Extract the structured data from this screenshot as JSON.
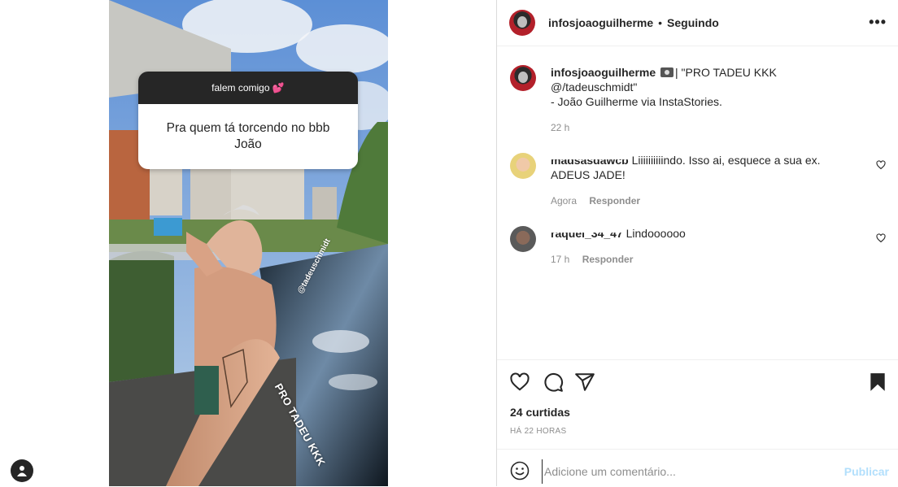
{
  "story": {
    "question_header": "falem comigo 💕",
    "question_text": "Pra quem tá torcendo  no bbb João",
    "mention_tag": "@tadeuschmidt",
    "caption_sticker": "PRO TADEU KKK"
  },
  "header": {
    "username": "infosjoaoguilherme",
    "separator": "•",
    "follow_status": "Seguindo"
  },
  "post": {
    "caption_user": "infosjoaoguilherme",
    "caption_line1": "| \"PRO TADEU KKK",
    "caption_line2": "@/tadeuschmidt\"",
    "caption_line3": "- João Guilherme via InstaStories.",
    "time": "22 h"
  },
  "comments": [
    {
      "user": "madsasdawcb",
      "text": "Liiiiiiiiiindo. Isso ai, esquece a sua ex. ADEUS JADE!",
      "time": "Agora",
      "reply": "Responder"
    },
    {
      "user": "raquel_34_47",
      "text": "Lindoooooo",
      "time": "17 h",
      "reply": "Responder"
    }
  ],
  "actions": {
    "likes": "24 curtidas",
    "posted_ago": "HÁ 22 HORAS"
  },
  "comment_box": {
    "placeholder": "Adicione um comentário...",
    "publish": "Publicar"
  },
  "icons": [
    "heart-icon",
    "comment-icon",
    "share-icon",
    "bookmark-icon",
    "emoji-icon",
    "more-icon",
    "profile-icon"
  ],
  "colors": {
    "text": "#262626",
    "muted": "#8e8e8e",
    "publish_disabled": "#b2dffc",
    "question_header_bg": "#262626"
  }
}
